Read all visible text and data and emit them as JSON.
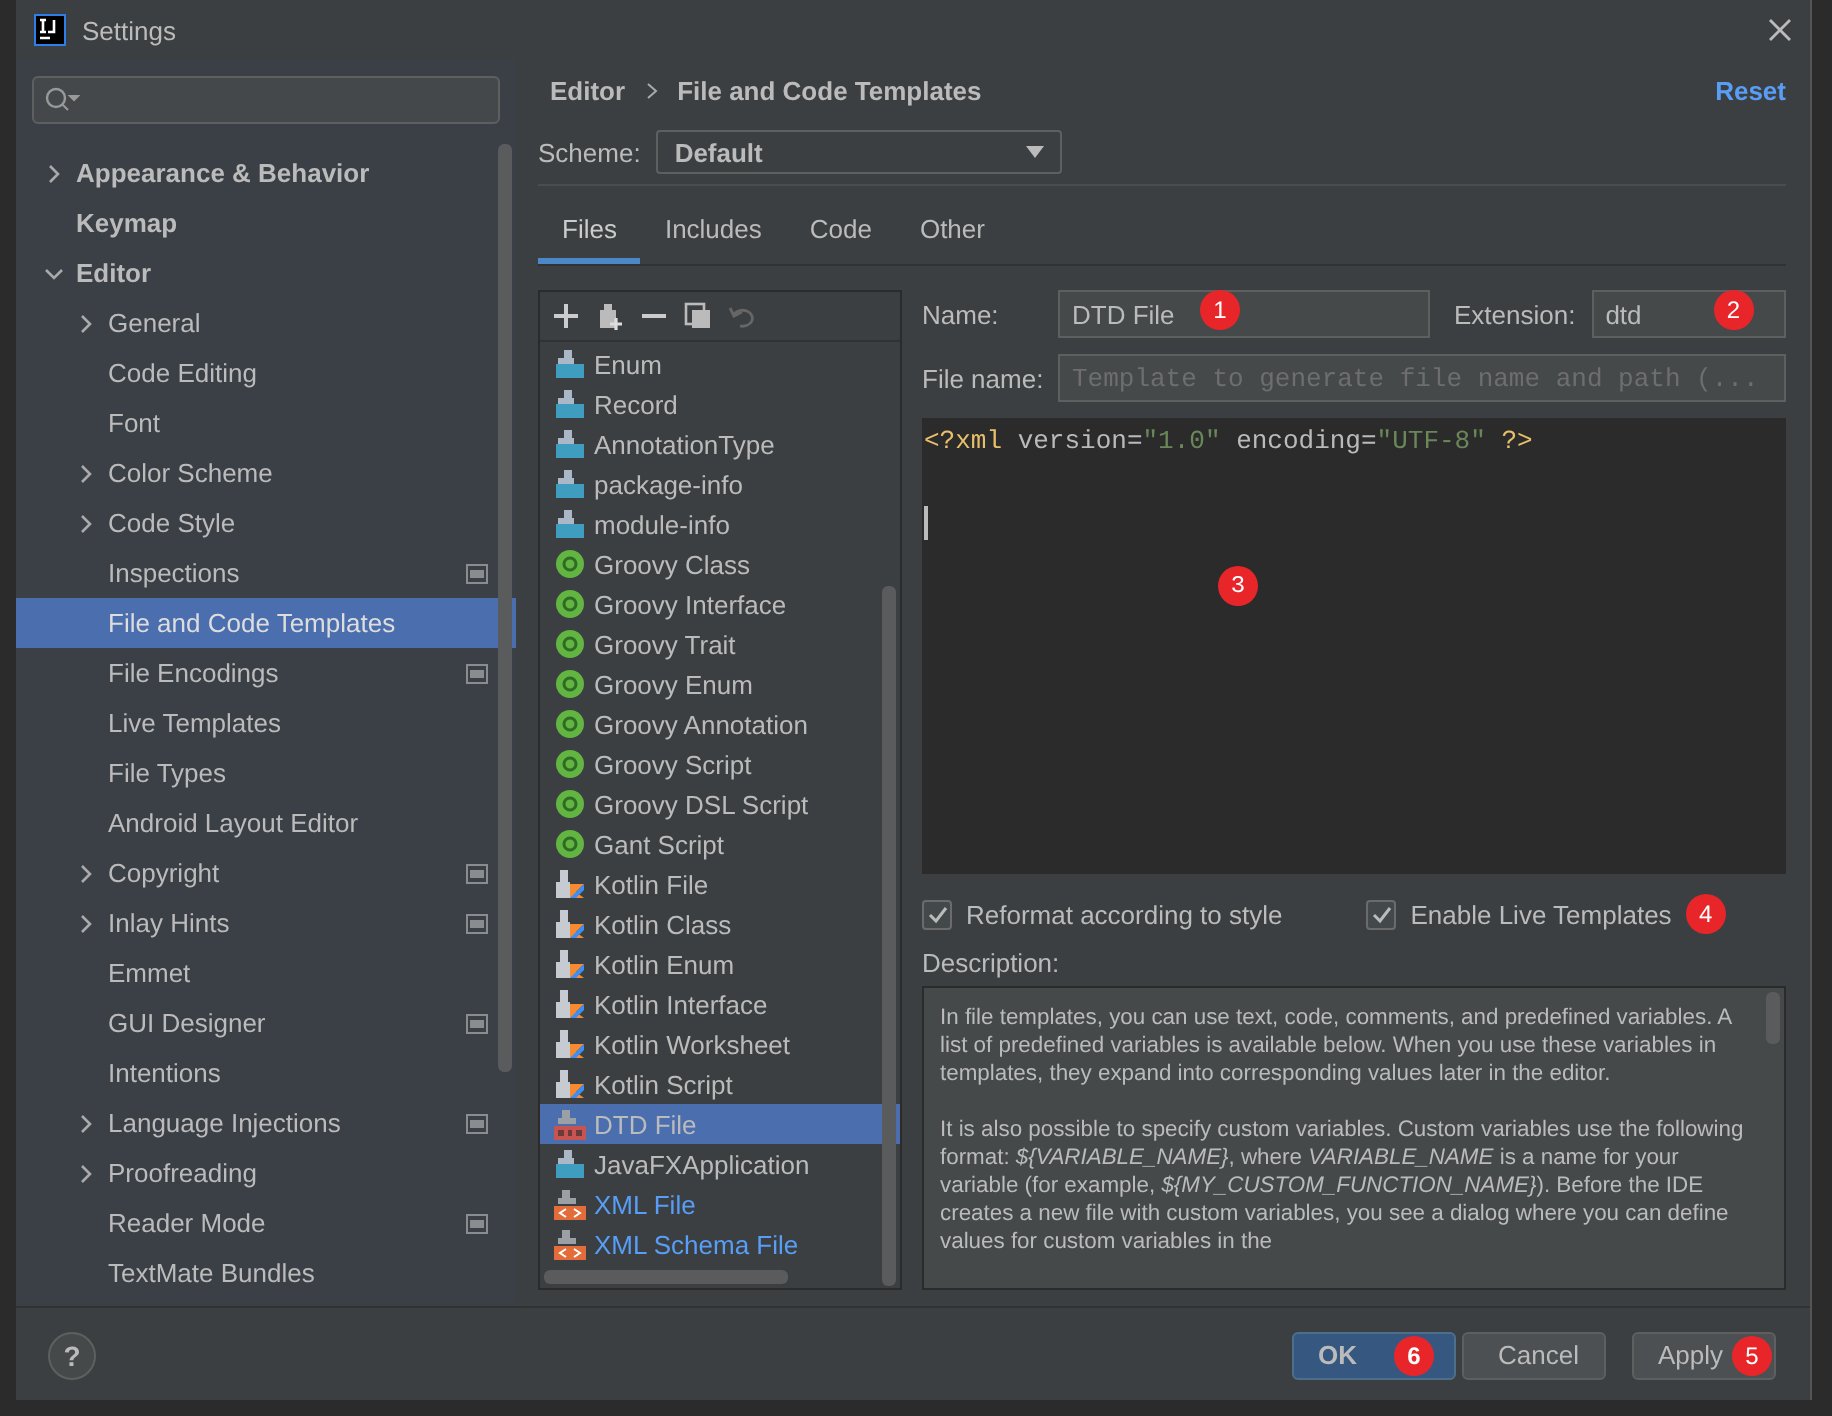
{
  "window": {
    "title": "Settings"
  },
  "sidebar": {
    "items": [
      {
        "label": "Appearance & Behavior",
        "expanded": false,
        "bold": true,
        "selected": false
      },
      {
        "label": "Keymap",
        "bold": true,
        "selected": false
      },
      {
        "label": "Editor",
        "expanded": true,
        "bold": true,
        "selected": false,
        "children": [
          {
            "label": "General",
            "expanded": false,
            "selected": false
          },
          {
            "label": "Code Editing",
            "selected": false
          },
          {
            "label": "Font",
            "selected": false
          },
          {
            "label": "Color Scheme",
            "expanded": false,
            "selected": false
          },
          {
            "label": "Code Style",
            "expanded": false,
            "selected": false
          },
          {
            "label": "Inspections",
            "project_scope": true,
            "selected": false
          },
          {
            "label": "File and Code Templates",
            "selected": true
          },
          {
            "label": "File Encodings",
            "project_scope": true,
            "selected": false
          },
          {
            "label": "Live Templates",
            "selected": false
          },
          {
            "label": "File Types",
            "selected": false
          },
          {
            "label": "Android Layout Editor",
            "selected": false
          },
          {
            "label": "Copyright",
            "expanded": false,
            "project_scope": true,
            "selected": false
          },
          {
            "label": "Inlay Hints",
            "expanded": false,
            "project_scope": true,
            "selected": false
          },
          {
            "label": "Emmet",
            "selected": false
          },
          {
            "label": "GUI Designer",
            "project_scope": true,
            "selected": false
          },
          {
            "label": "Intentions",
            "selected": false
          },
          {
            "label": "Language Injections",
            "expanded": false,
            "project_scope": true,
            "selected": false
          },
          {
            "label": "Proofreading",
            "expanded": false,
            "selected": false
          },
          {
            "label": "Reader Mode",
            "project_scope": true,
            "selected": false
          },
          {
            "label": "TextMate Bundles",
            "selected": false
          }
        ]
      }
    ]
  },
  "breadcrumb": [
    "Editor",
    "File and Code Templates"
  ],
  "reset": "Reset",
  "scheme": {
    "label": "Scheme:",
    "value": "Default"
  },
  "tabs": [
    {
      "label": "Files",
      "selected": true
    },
    {
      "label": "Includes",
      "selected": false
    },
    {
      "label": "Code",
      "selected": false
    },
    {
      "label": "Other",
      "selected": false
    }
  ],
  "templates": [
    {
      "label": "Enum",
      "kind": "java",
      "modified": false,
      "selected": false
    },
    {
      "label": "Record",
      "kind": "java",
      "modified": false,
      "selected": false
    },
    {
      "label": "AnnotationType",
      "kind": "java",
      "modified": false,
      "selected": false
    },
    {
      "label": "package-info",
      "kind": "java",
      "modified": false,
      "selected": false
    },
    {
      "label": "module-info",
      "kind": "java",
      "modified": false,
      "selected": false
    },
    {
      "label": "Groovy Class",
      "kind": "groovy",
      "modified": false,
      "selected": false
    },
    {
      "label": "Groovy Interface",
      "kind": "groovy",
      "modified": false,
      "selected": false
    },
    {
      "label": "Groovy Trait",
      "kind": "groovy",
      "modified": false,
      "selected": false
    },
    {
      "label": "Groovy Enum",
      "kind": "groovy",
      "modified": false,
      "selected": false
    },
    {
      "label": "Groovy Annotation",
      "kind": "groovy",
      "modified": false,
      "selected": false
    },
    {
      "label": "Groovy Script",
      "kind": "groovy",
      "modified": false,
      "selected": false
    },
    {
      "label": "Groovy DSL Script",
      "kind": "groovy",
      "modified": false,
      "selected": false
    },
    {
      "label": "Gant Script",
      "kind": "groovy",
      "modified": false,
      "selected": false
    },
    {
      "label": "Kotlin File",
      "kind": "kotlin",
      "modified": false,
      "selected": false
    },
    {
      "label": "Kotlin Class",
      "kind": "kotlin",
      "modified": false,
      "selected": false
    },
    {
      "label": "Kotlin Enum",
      "kind": "kotlin",
      "modified": false,
      "selected": false
    },
    {
      "label": "Kotlin Interface",
      "kind": "kotlin",
      "modified": false,
      "selected": false
    },
    {
      "label": "Kotlin Worksheet",
      "kind": "kotlin",
      "modified": false,
      "selected": false
    },
    {
      "label": "Kotlin Script",
      "kind": "kotlin",
      "modified": false,
      "selected": false
    },
    {
      "label": "DTD File",
      "kind": "dtd",
      "modified": false,
      "selected": true
    },
    {
      "label": "JavaFXApplication",
      "kind": "java",
      "modified": false,
      "selected": false
    },
    {
      "label": "XML File",
      "kind": "xml",
      "modified": true,
      "selected": false
    },
    {
      "label": "XML Schema File",
      "kind": "xml",
      "modified": true,
      "selected": false
    }
  ],
  "form": {
    "name": {
      "label": "Name:",
      "value": "DTD File",
      "badge": "1"
    },
    "extension": {
      "label": "Extension:",
      "value": "dtd",
      "badge": "2"
    },
    "file_name": {
      "label": "File name:",
      "placeholder": "Template to generate file name and path (..."
    },
    "editor": {
      "badge": "3",
      "lines": [
        [
          {
            "text": "<?xml",
            "kind": "tag"
          },
          {
            "text": " version",
            "kind": "attr"
          },
          {
            "text": "=",
            "kind": "attr"
          },
          {
            "text": "\"1.0\"",
            "kind": "value"
          },
          {
            "text": " encoding",
            "kind": "attr"
          },
          {
            "text": "=",
            "kind": "attr"
          },
          {
            "text": "\"UTF-8\"",
            "kind": "value"
          },
          {
            "text": " ?>",
            "kind": "tag"
          }
        ]
      ]
    },
    "options": [
      {
        "label": "Reformat according to style",
        "checked": true
      },
      {
        "label": "Enable Live Templates",
        "checked": true,
        "badge": "4"
      }
    ],
    "description_label": "Description:",
    "description": [
      "In file templates, you can use text, code, comments, and predefined variables. A list of predefined variables is available below. When you use these variables in templates, they expand into corresponding values later in the editor.",
      "It is also possible to specify custom variables. Custom variables use the following format: *${VARIABLE_NAME}*, where *VARIABLE_NAME* is a name for your variable (for example, *${MY_CUSTOM_FUNCTION_NAME}*). Before the IDE creates a new file with custom variables, you see a dialog where you can define values for custom variables in the"
    ]
  },
  "help": "?",
  "buttons": [
    {
      "label": "OK",
      "primary": true,
      "badge": "6"
    },
    {
      "label": "Cancel",
      "primary": false
    },
    {
      "label": "Apply",
      "primary": false,
      "badge": "5"
    }
  ]
}
